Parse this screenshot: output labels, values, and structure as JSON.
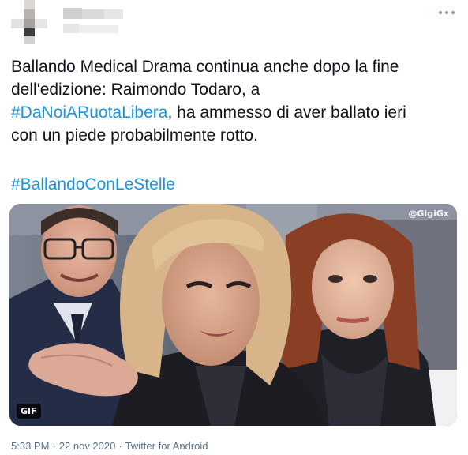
{
  "tweet": {
    "text_lines": [
      "Ballando Medical Drama continua anche dopo la fine",
      "dell'edizione: Raimondo Todaro, a"
    ],
    "line3_hashtag": "#DaNoiARuotaLibera",
    "line3_rest": ", ha ammesso di aver ballato ieri",
    "line4": "con un piede probabilmente rotto.",
    "hashtag_2": "#BallandoConLeStelle"
  },
  "media": {
    "watermark": "@GigiGx",
    "badge": "GIF"
  },
  "footer": {
    "time": "5:33 PM",
    "separator": "·",
    "date": "22 nov 2020",
    "source": "Twitter for Android"
  },
  "icons": {
    "more": "more-horizontal-icon"
  },
  "colors": {
    "link": "#1b95e0",
    "text": "#0f1419",
    "meta": "#5b7083"
  }
}
